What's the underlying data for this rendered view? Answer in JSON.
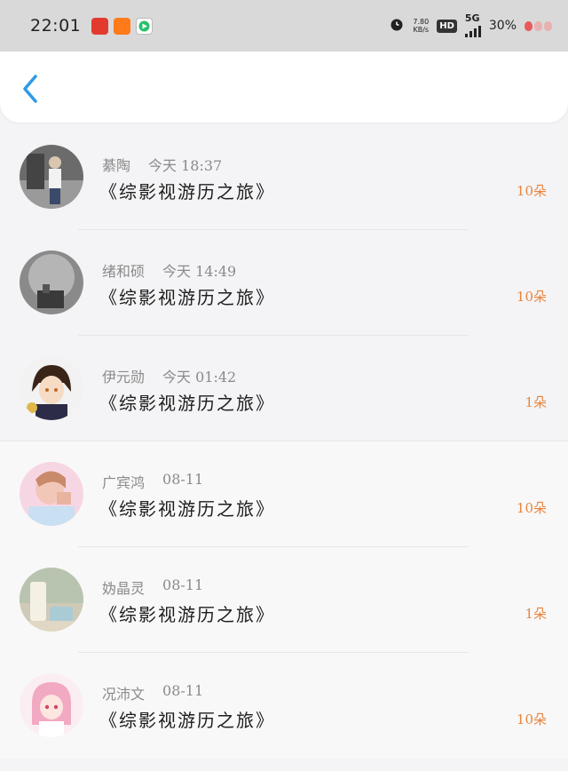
{
  "status_bar": {
    "time": "22:01",
    "net_speed": "7.80",
    "net_unit": "KB/s",
    "hd": "HD",
    "signal": "5G",
    "battery": "30%"
  },
  "items": [
    {
      "name": "綦陶",
      "time": "今天 18:37",
      "title": "《综影视游历之旅》",
      "amount": "10朵"
    },
    {
      "name": "绪和硕",
      "time": "今天 14:49",
      "title": "《综影视游历之旅》",
      "amount": "10朵"
    },
    {
      "name": "伊元勋",
      "time": "今天 01:42",
      "title": "《综影视游历之旅》",
      "amount": "1朵"
    },
    {
      "name": "广宾鸿",
      "time": "08-11",
      "title": "《综影视游历之旅》",
      "amount": "10朵"
    },
    {
      "name": "妫晶灵",
      "time": "08-11",
      "title": "《综影视游历之旅》",
      "amount": "1朵"
    },
    {
      "name": "况沛文",
      "time": "08-11",
      "title": "《综影视游历之旅》",
      "amount": "10朵"
    }
  ]
}
